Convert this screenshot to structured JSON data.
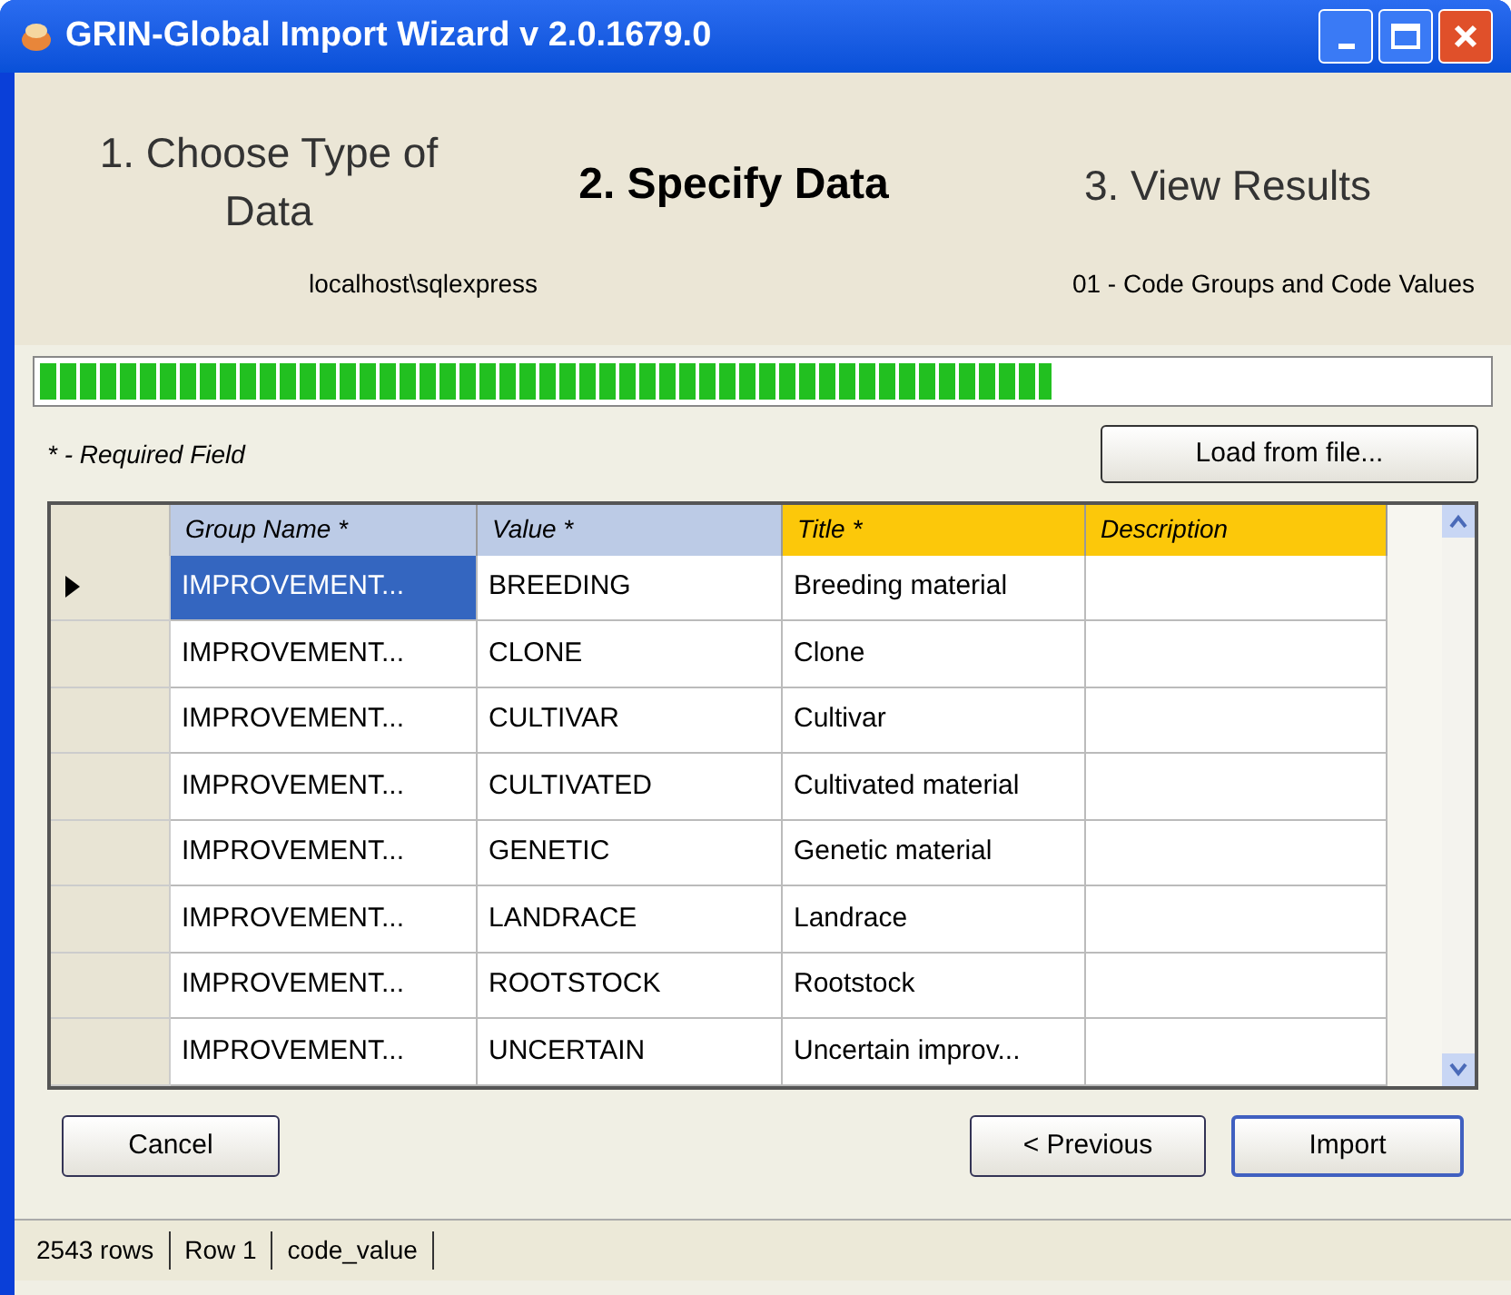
{
  "window": {
    "title": "GRIN-Global Import Wizard v 2.0.1679.0"
  },
  "steps": [
    {
      "label": "1.  Choose Type of Data",
      "selected": false
    },
    {
      "label": "2. Specify Data",
      "selected": true
    },
    {
      "label": "3.  View Results",
      "selected": false
    }
  ],
  "connection": "localhost\\sqlexpress",
  "dataset": "01 - Code Groups and Code Values",
  "progress": {
    "level": 0.7
  },
  "required_note": "* - Required Field",
  "load_button": "Load from file...",
  "table": {
    "columns": [
      {
        "label": "Group Name *",
        "highlighted": false
      },
      {
        "label": "Value *",
        "highlighted": false
      },
      {
        "label": "Title *",
        "highlighted": true
      },
      {
        "label": "Description",
        "highlighted": true
      }
    ],
    "rows": [
      {
        "current": true,
        "cells": [
          {
            "text": "IMPROVEMENT...",
            "selected": true
          },
          {
            "text": "BREEDING",
            "selected": false
          },
          {
            "text": "Breeding material",
            "selected": false
          },
          {
            "text": "",
            "selected": false
          }
        ]
      },
      {
        "current": false,
        "cells": [
          {
            "text": "IMPROVEMENT...",
            "selected": false
          },
          {
            "text": "CLONE",
            "selected": false
          },
          {
            "text": "Clone",
            "selected": false
          },
          {
            "text": "",
            "selected": false
          }
        ]
      },
      {
        "current": false,
        "cells": [
          {
            "text": "IMPROVEMENT...",
            "selected": false
          },
          {
            "text": "CULTIVAR",
            "selected": false
          },
          {
            "text": "Cultivar",
            "selected": false
          },
          {
            "text": "",
            "selected": false
          }
        ]
      },
      {
        "current": false,
        "cells": [
          {
            "text": "IMPROVEMENT...",
            "selected": false
          },
          {
            "text": "CULTIVATED",
            "selected": false
          },
          {
            "text": "Cultivated material",
            "selected": false
          },
          {
            "text": "",
            "selected": false
          }
        ]
      },
      {
        "current": false,
        "cells": [
          {
            "text": "IMPROVEMENT...",
            "selected": false
          },
          {
            "text": "GENETIC",
            "selected": false
          },
          {
            "text": "Genetic material",
            "selected": false
          },
          {
            "text": "",
            "selected": false
          }
        ]
      },
      {
        "current": false,
        "cells": [
          {
            "text": "IMPROVEMENT...",
            "selected": false
          },
          {
            "text": "LANDRACE",
            "selected": false
          },
          {
            "text": "Landrace",
            "selected": false
          },
          {
            "text": "",
            "selected": false
          }
        ]
      },
      {
        "current": false,
        "cells": [
          {
            "text": "IMPROVEMENT...",
            "selected": false
          },
          {
            "text": "ROOTSTOCK",
            "selected": false
          },
          {
            "text": "Rootstock",
            "selected": false
          },
          {
            "text": "",
            "selected": false
          }
        ]
      },
      {
        "current": false,
        "cells": [
          {
            "text": "IMPROVEMENT...",
            "selected": false
          },
          {
            "text": "UNCERTAIN",
            "selected": false
          },
          {
            "text": "Uncertain improv...",
            "selected": false
          },
          {
            "text": "",
            "selected": false
          }
        ]
      }
    ]
  },
  "buttons": {
    "cancel": "Cancel",
    "previous": "< Previous",
    "import": "Import"
  },
  "status_bar": [
    "2543 rows",
    "Row 1",
    "code_value"
  ]
}
